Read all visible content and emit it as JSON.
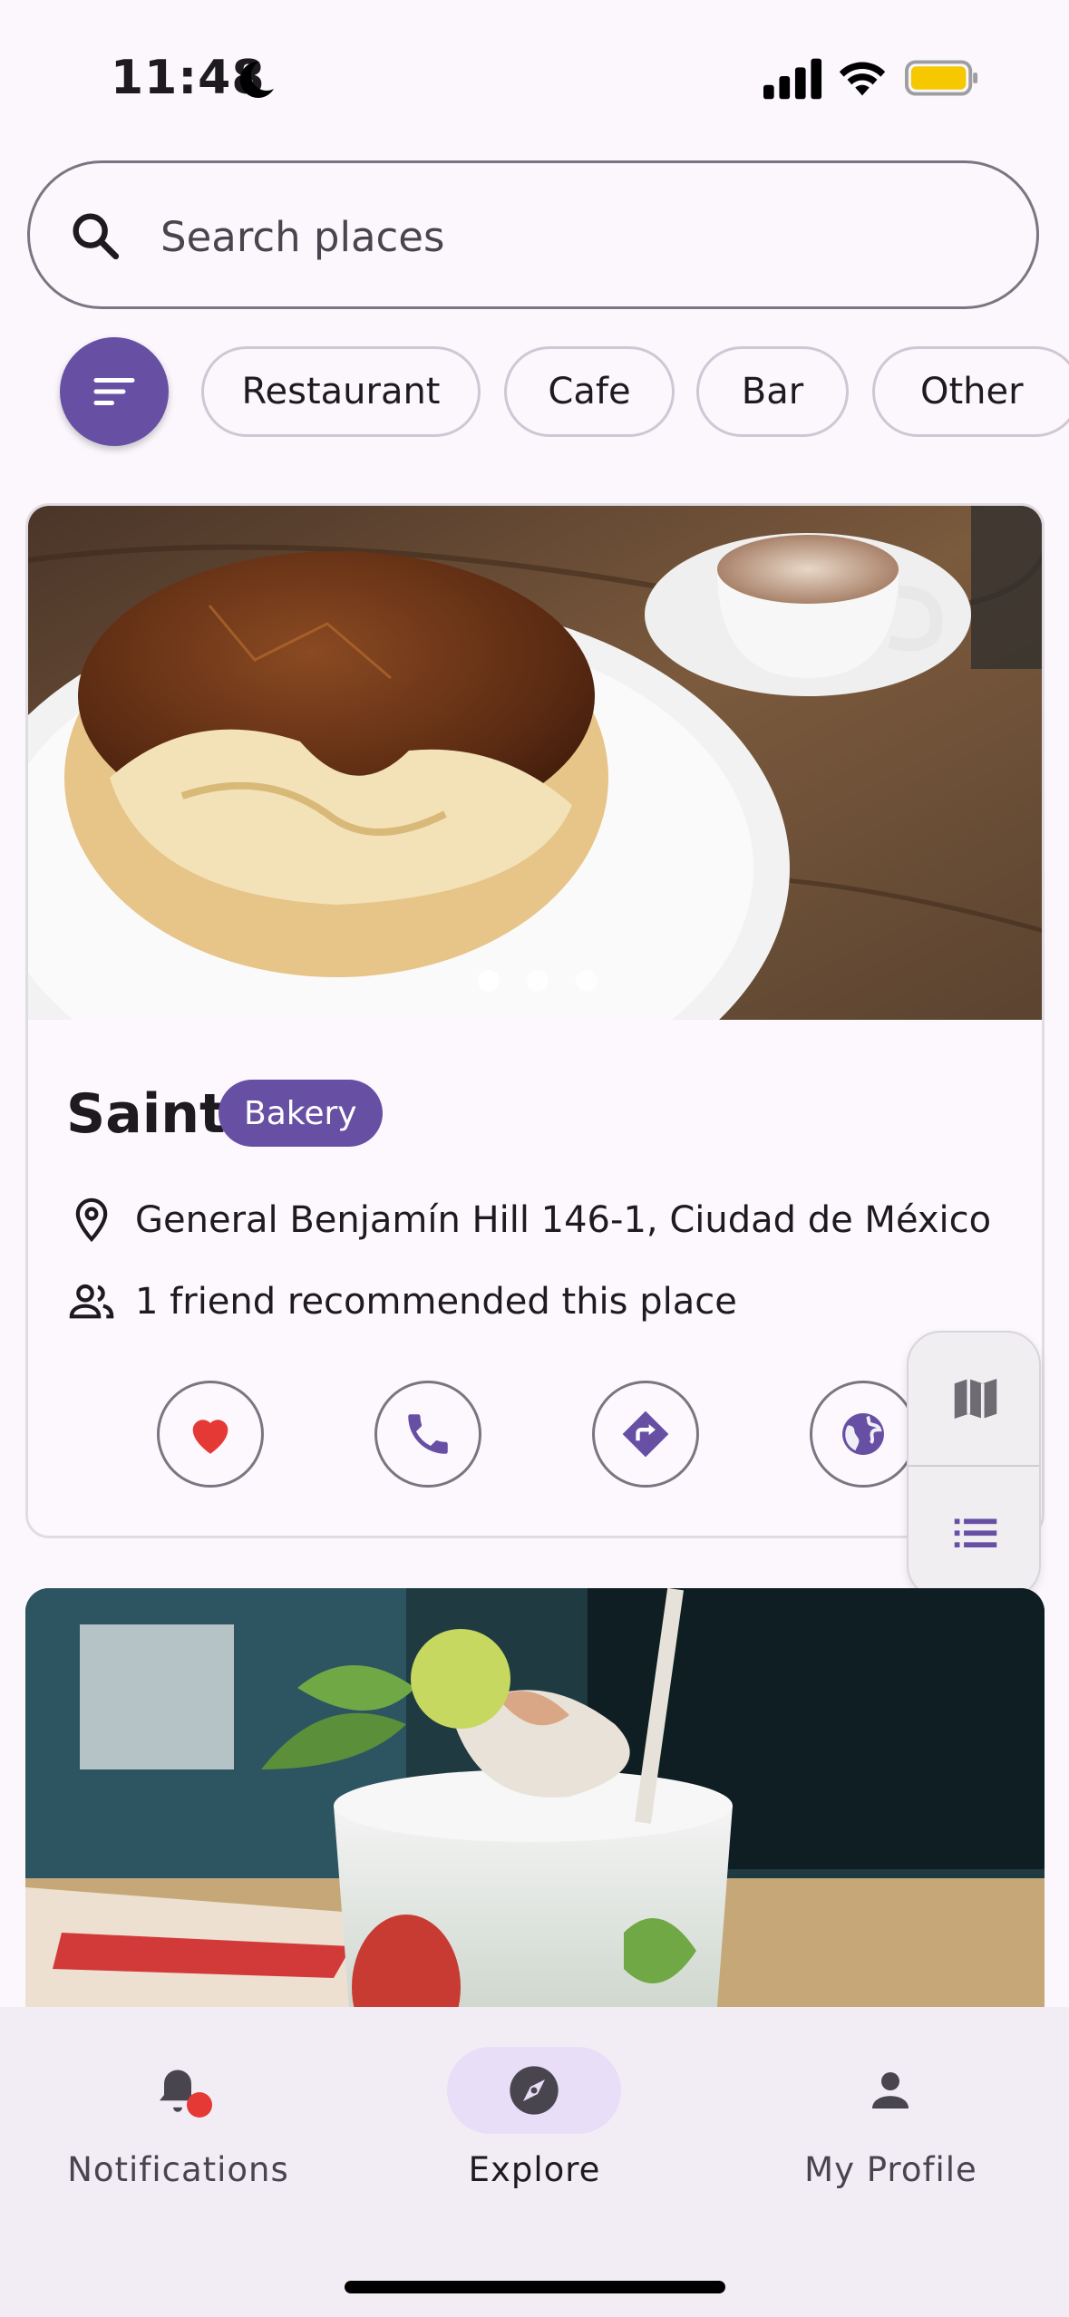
{
  "status": {
    "time": "11:48"
  },
  "search": {
    "placeholder": "Search places"
  },
  "filters": {
    "chips": [
      "Restaurant",
      "Cafe",
      "Bar",
      "Other"
    ]
  },
  "place": {
    "name": "Saint",
    "category": "Bakery",
    "address": "General Benjamín Hill 146-1, Ciudad de México",
    "friends_text": "1 friend recommended this place",
    "photo_count": 3,
    "active_photo": 1
  },
  "nav": {
    "items": [
      {
        "label": "Notifications",
        "icon": "bell-icon"
      },
      {
        "label": "Explore",
        "icon": "compass-icon"
      },
      {
        "label": "My Profile",
        "icon": "person-icon"
      }
    ],
    "active": "Explore"
  },
  "colors": {
    "primary": "#6750A4",
    "favorite": "#E53935",
    "battery": "#F5C800",
    "background": "#FBF7FD"
  }
}
